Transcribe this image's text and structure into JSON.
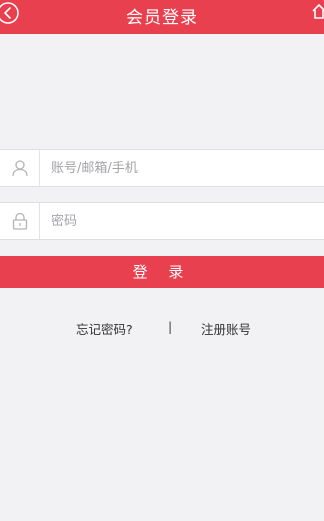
{
  "header": {
    "title": "会员登录",
    "back_icon": "chevron-left-circle-icon",
    "home_icon": "home-icon"
  },
  "form": {
    "username": {
      "icon": "user-icon",
      "placeholder": "账号/邮箱/手机",
      "value": ""
    },
    "password": {
      "icon": "lock-icon",
      "placeholder": "密码",
      "value": ""
    },
    "login_label": "登 录"
  },
  "links": {
    "forgot_password": "忘记密码?",
    "separator": "|",
    "register": "注册账号"
  },
  "colors": {
    "accent": "#e8404e",
    "background": "#f2f1f3"
  }
}
